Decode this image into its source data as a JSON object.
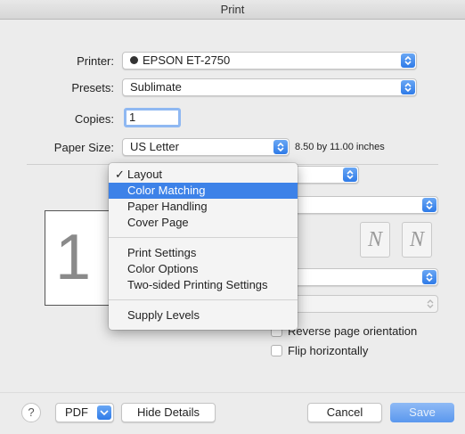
{
  "window": {
    "title": "Print"
  },
  "printer": {
    "label": "Printer:",
    "value": "EPSON ET-2750"
  },
  "presets": {
    "label": "Presets:",
    "value": "Sublimate"
  },
  "copies": {
    "label": "Copies:",
    "value": "1"
  },
  "paper_size": {
    "label": "Paper Size:",
    "value": "US Letter",
    "info": "8.50 by 11.00 inches"
  },
  "preview": {
    "page_number": "1"
  },
  "menu": {
    "items": [
      {
        "label": "Layout",
        "checked": true
      },
      {
        "label": "Color Matching",
        "selected": true
      },
      {
        "label": "Paper Handling"
      },
      {
        "label": "Cover Page"
      },
      {
        "label": "Print Settings"
      },
      {
        "label": "Color Options"
      },
      {
        "label": "Two-sided Printing Settings"
      },
      {
        "label": "Supply Levels"
      }
    ]
  },
  "options": {
    "reverse_orientation_label": "Reverse page orientation",
    "flip_horizontal_label": "Flip horizontally",
    "orientation_glyphs": [
      "N",
      "N"
    ]
  },
  "footer": {
    "help": "?",
    "pdf": "PDF",
    "hide_details": "Hide Details",
    "cancel": "Cancel",
    "save": "Save"
  },
  "colors": {
    "accent": "#3d82e8",
    "selection": "#3d82e8"
  }
}
